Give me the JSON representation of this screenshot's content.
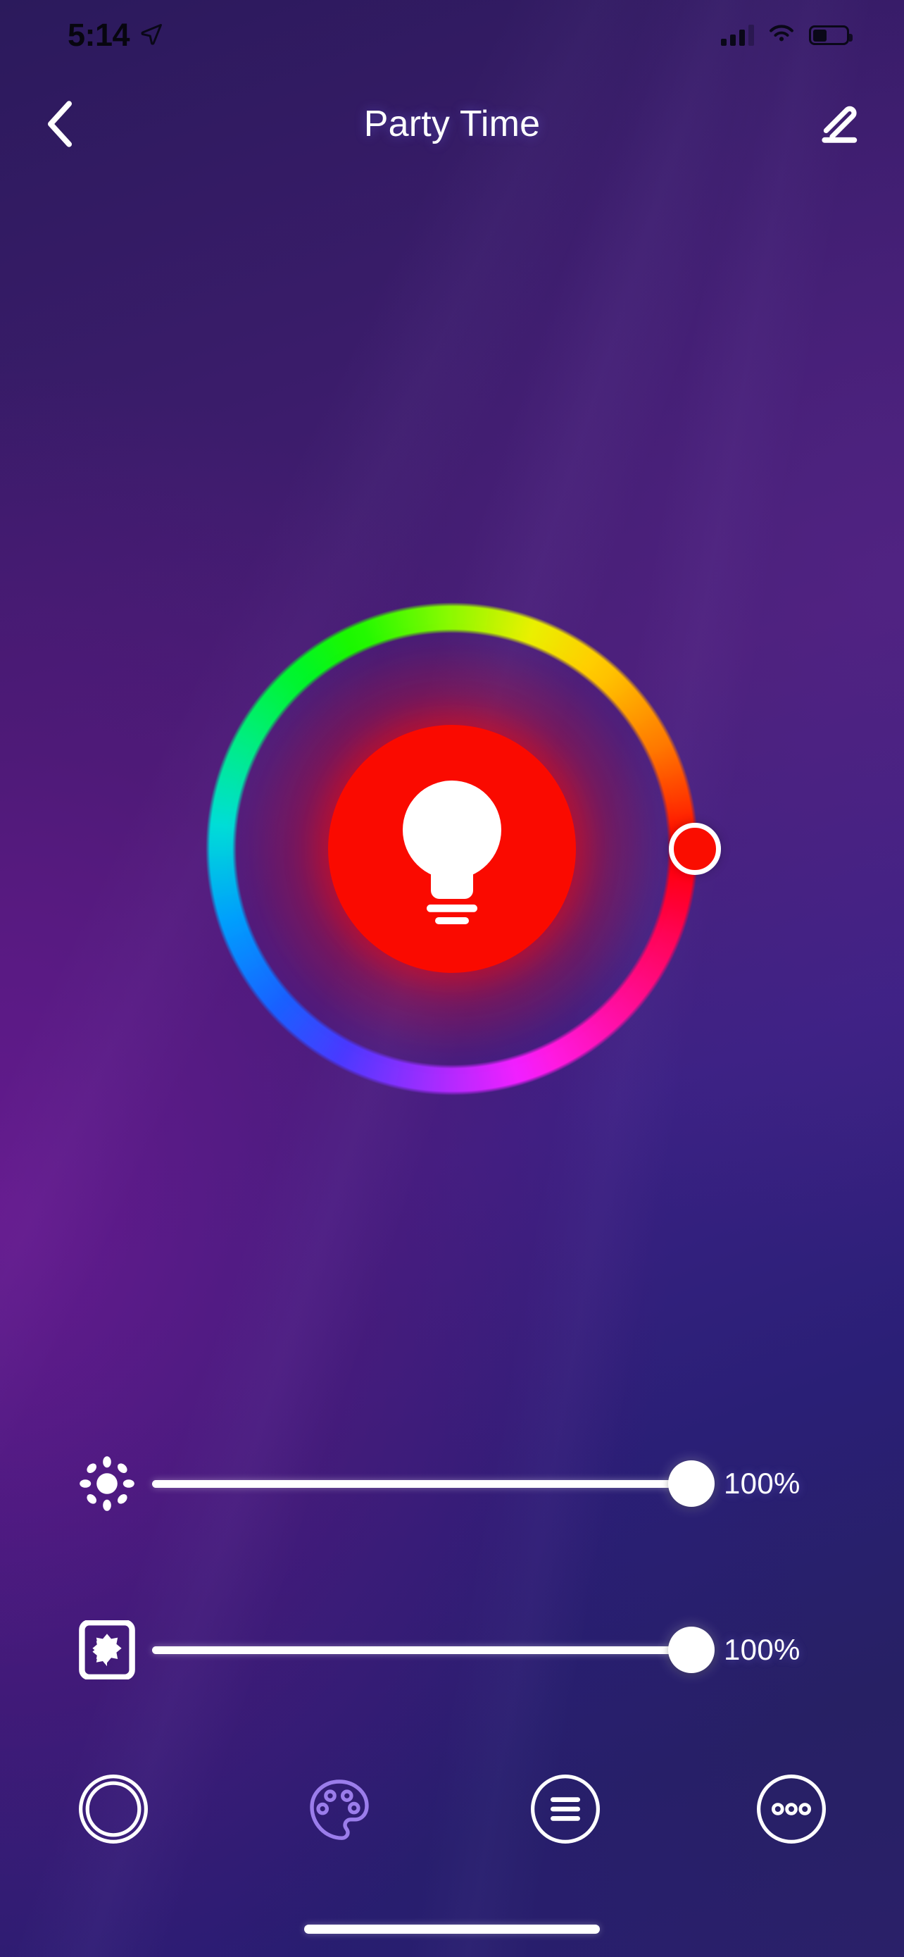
{
  "status_bar": {
    "time": "5:14",
    "location_icon": "location-arrow-icon",
    "cellular_icon": "cellular-signal-icon",
    "wifi_icon": "wifi-icon",
    "battery_icon": "battery-icon",
    "battery_level_pct": 42
  },
  "nav": {
    "back_icon": "chevron-left-icon",
    "title": "Party Time",
    "edit_icon": "pencil-edit-icon"
  },
  "color_wheel": {
    "name": "hue-color-wheel",
    "selected_color": "#FA0A00",
    "selected_hue_deg": 0,
    "handle_position": "right",
    "bulb_icon": "light-bulb-icon",
    "power_state": "on"
  },
  "sliders": [
    {
      "name": "brightness",
      "icon": "sun-brightness-icon",
      "value": 100,
      "value_label": "100%",
      "min": 0,
      "max": 100
    },
    {
      "name": "saturation",
      "icon": "contrast-saturation-icon",
      "value": 100,
      "value_label": "100%",
      "min": 0,
      "max": 100
    }
  ],
  "tabs": [
    {
      "name": "power",
      "icon": "power-circle-icon",
      "active": false,
      "color": "#FFFFFF"
    },
    {
      "name": "colors",
      "icon": "palette-icon",
      "active": true,
      "color": "#9B7DEB"
    },
    {
      "name": "scenes",
      "icon": "list-lines-icon",
      "active": false,
      "color": "#FFFFFF"
    },
    {
      "name": "more",
      "icon": "more-dots-icon",
      "active": false,
      "color": "#FFFFFF"
    }
  ],
  "home_indicator": {
    "name": "home-indicator"
  },
  "theme": {
    "background_top": "#291A57",
    "background_purple": "#4A1B70",
    "background_navy": "#1C1960",
    "accent": "#9B7DEB",
    "active_color": "#FA0A00"
  }
}
